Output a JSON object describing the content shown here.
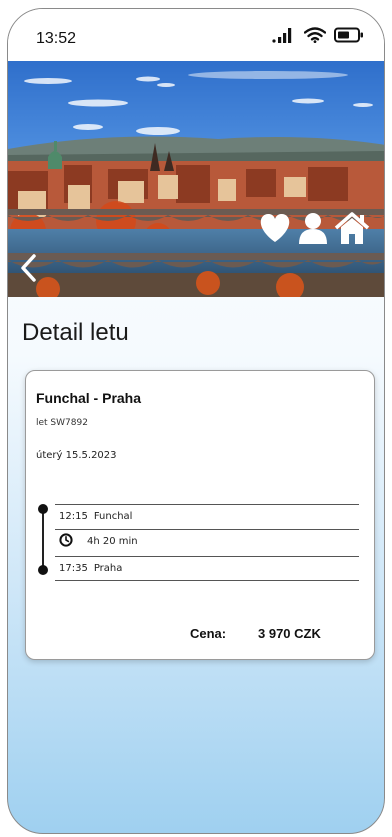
{
  "status_bar": {
    "time": "13:52",
    "icons": [
      "signal-icon",
      "wifi-icon",
      "battery-icon"
    ]
  },
  "hero": {
    "image": "prague-cityscape-photo",
    "back_icon": "chevron-left-icon",
    "actions": [
      "heart-icon",
      "user-icon",
      "home-icon"
    ]
  },
  "page": {
    "title": "Detail letu"
  },
  "flight": {
    "route": "Funchal - Praha",
    "number": "let SW7892",
    "date": "úterý 15.5.2023",
    "departure": {
      "time": "12:15",
      "place": "Funchal"
    },
    "duration": "4h 20 min",
    "arrival": {
      "time": "17:35",
      "place": "Praha"
    },
    "price_label": "Cena:",
    "price_value": "3 970 CZK"
  },
  "colors": {
    "sky": "#3f7fd6",
    "gradient_bottom": "#9fd0f0",
    "text": "#111111"
  }
}
